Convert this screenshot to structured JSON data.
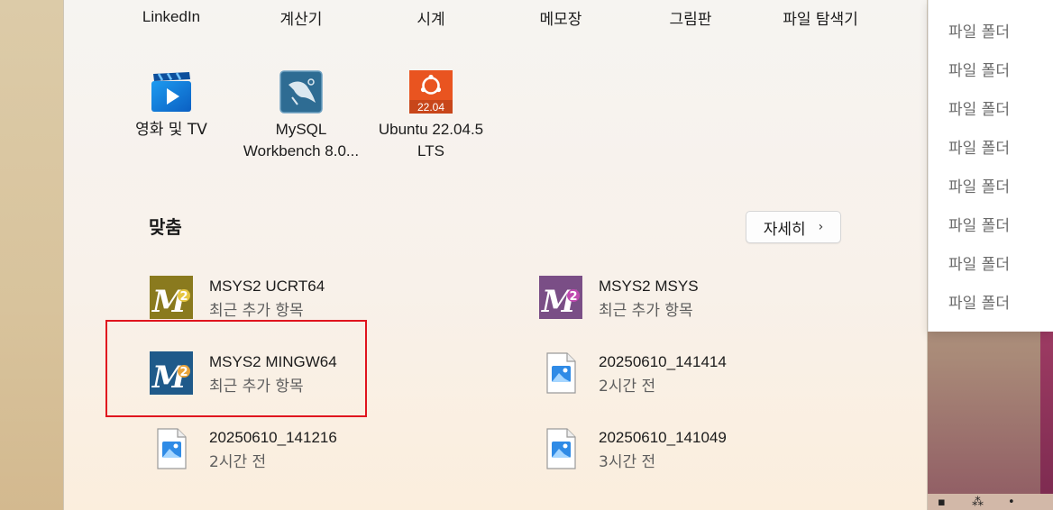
{
  "top_row": {
    "labels": [
      "LinkedIn",
      "계산기",
      "시계",
      "메모장",
      "그림판",
      "파일 탐색기"
    ]
  },
  "pinned_apps": [
    {
      "name": "영화 및 TV",
      "icon": "movies-tv-icon"
    },
    {
      "name_line1": "MySQL",
      "name_line2": "Workbench 8.0...",
      "icon": "mysql-workbench-icon"
    },
    {
      "name_line1": "Ubuntu 22.04.5",
      "name_line2": "LTS",
      "icon": "ubuntu-icon",
      "badge": "22.04"
    }
  ],
  "recommended": {
    "title": "맞춤",
    "more_label": "자세히",
    "more_chevron": "›",
    "items": [
      {
        "name": "MSYS2 UCRT64",
        "sub": "최근 추가 항목",
        "icon": "msys2-ucrt64-icon",
        "color": "#8a7a1e"
      },
      {
        "name": "MSYS2 MSYS",
        "sub": "최근 추가 항목",
        "icon": "msys2-msys-icon",
        "color": "#7a4e86"
      },
      {
        "name": "MSYS2 MINGW64",
        "sub": "최근 추가 항목",
        "icon": "msys2-mingw64-icon",
        "color": "#1f5a8a"
      },
      {
        "name": "20250610_141414",
        "sub": "2시간 전",
        "icon": "image-file-icon"
      },
      {
        "name": "20250610_141216",
        "sub": "2시간 전",
        "icon": "image-file-icon"
      },
      {
        "name": "20250610_141049",
        "sub": "3시간 전",
        "icon": "image-file-icon"
      }
    ]
  },
  "flyout": {
    "items": [
      "파일 폴더",
      "파일 폴더",
      "파일 폴더",
      "파일 폴더",
      "파일 폴더",
      "파일 폴더",
      "파일 폴더",
      "파일 폴더"
    ]
  },
  "colors": {
    "highlight": "#e0141e",
    "accent_blue": "#1f78d1",
    "ubuntu_orange": "#e95420"
  }
}
